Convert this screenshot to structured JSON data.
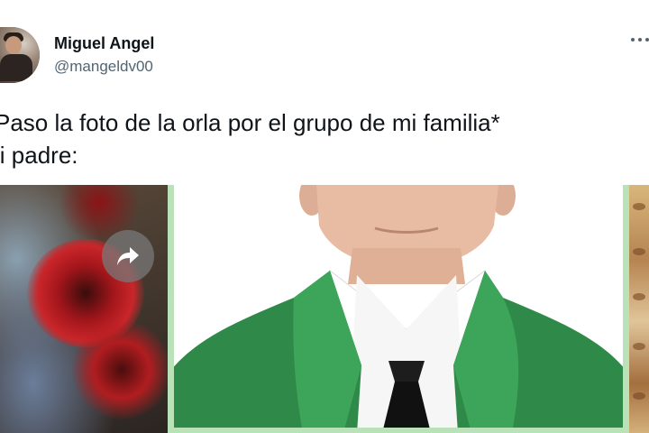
{
  "tweet": {
    "author": {
      "display_name": "Miguel Angel",
      "handle": "@mangeldv00"
    },
    "text_lines": [
      "Paso la foto de la orla por el grupo de mi familia*",
      "li padre:"
    ]
  },
  "icons": {
    "more": "more-dots-icon",
    "share": "share-arrow-icon"
  },
  "colors": {
    "text_primary": "#0f1419",
    "text_secondary": "#536471",
    "gown_green": "#2f8a49",
    "frame_green": "#b9e2b8"
  }
}
